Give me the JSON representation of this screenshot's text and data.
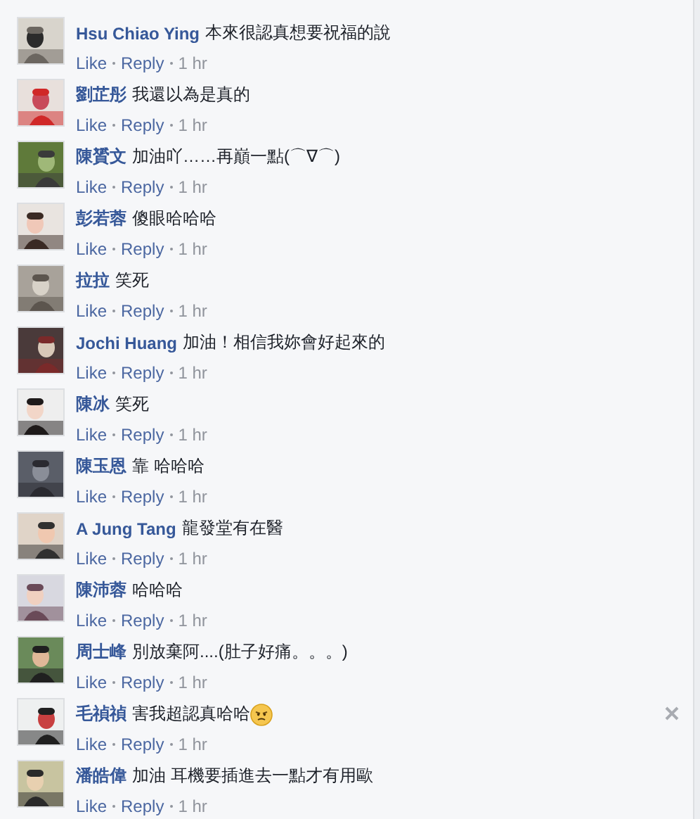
{
  "comments": [
    {
      "author": "Hsu Chiao Ying",
      "text": "本來很認真想要祝福的說",
      "actions": [
        "Like",
        "Reply"
      ],
      "time": "1 hr"
    },
    {
      "author": "劉芷彤",
      "text": "我還以為是真的",
      "actions": [
        "Like",
        "Reply"
      ],
      "time": "1 hr"
    },
    {
      "author": "陳贇文",
      "text": "加油吖……再巔一點(⌒∇⌒)",
      "actions": [
        "Like",
        "Reply"
      ],
      "time": "1 hr"
    },
    {
      "author": "彭若蓉",
      "text": "傻眼哈哈哈",
      "actions": [
        "Like",
        "Reply"
      ],
      "time": "1 hr"
    },
    {
      "author": "拉拉",
      "text": "笑死",
      "actions": [
        "Like",
        "Reply"
      ],
      "time": "1 hr"
    },
    {
      "author": "Jochi Huang",
      "text": "加油！相信我妳會好起來的",
      "actions": [
        "Like",
        "Reply"
      ],
      "time": "1 hr"
    },
    {
      "author": "陳冰",
      "text": "笑死",
      "actions": [
        "Like",
        "Reply"
      ],
      "time": "1 hr"
    },
    {
      "author": "陳玉恩",
      "text": "靠 哈哈哈",
      "actions": [
        "Like",
        "Reply"
      ],
      "time": "1 hr"
    },
    {
      "author": "A Jung Tang",
      "text": "龍發堂有在醫",
      "actions": [
        "Like",
        "Reply"
      ],
      "time": "1 hr"
    },
    {
      "author": "陳沛蓉",
      "text": "哈哈哈",
      "actions": [
        "Like",
        "Reply"
      ],
      "time": "1 hr"
    },
    {
      "author": "周士峰",
      "text": "別放棄阿....(肚子好痛。。。)",
      "actions": [
        "Like",
        "Reply"
      ],
      "time": "1 hr"
    },
    {
      "author": "毛禎禎",
      "text": "害我超認真哈哈",
      "emoji": true,
      "hovered": true,
      "actions": [
        "Like",
        "Reply"
      ],
      "time": "1 hr"
    },
    {
      "author": "潘皓偉",
      "text": "加油 耳機要插進去一點才有用歐",
      "actions": [
        "Like",
        "Reply"
      ],
      "time": "1 hr"
    }
  ]
}
